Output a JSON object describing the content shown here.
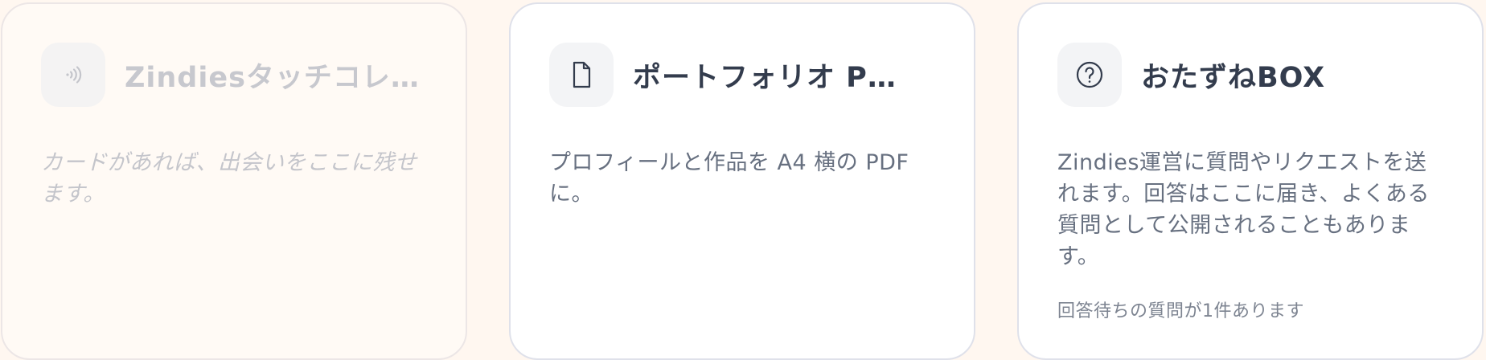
{
  "cards": [
    {
      "title": "Zindiesタッチコレク…",
      "description": "カードがあれば、出会いをここに残せます。",
      "icon": "nfc-icon",
      "state": "disabled"
    },
    {
      "title": "ポートフォリオ P…",
      "description": "プロフィールと作品を A4 横の PDF に。",
      "icon": "document-icon",
      "state": "enabled"
    },
    {
      "title": "おたずねBOX",
      "description": "Zindies運営に質問やリクエストを送れます。回答はここに届き、よくある質問として公開されることもあります。",
      "note": "回答待ちの質問が1件あります",
      "icon": "question-circle-icon",
      "state": "enabled"
    }
  ],
  "colors": {
    "page_background": "#fff7f0",
    "card_background": "#ffffff",
    "card_border": "#dfe1ea",
    "title_text": "#333c4d",
    "body_text": "#677080",
    "disabled_text": "#c4c5cb",
    "icon_background": "#f3f4f6"
  }
}
